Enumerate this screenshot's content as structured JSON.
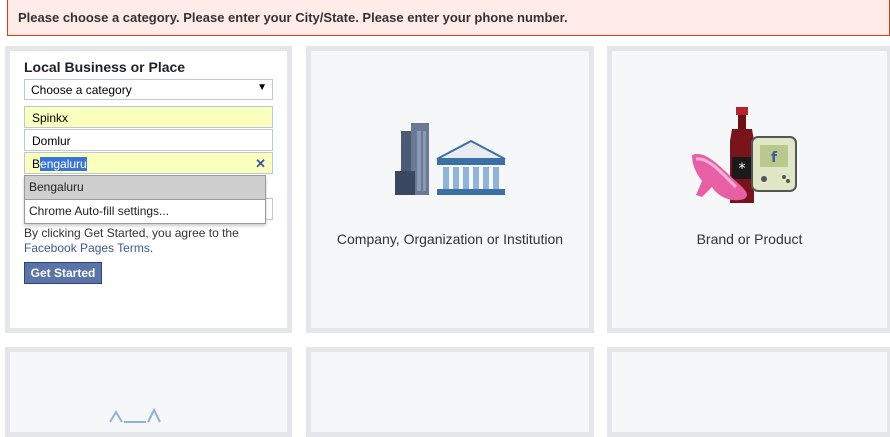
{
  "error": {
    "message": "Please choose a category. Please enter your City/State. Please enter your phone number."
  },
  "local_business": {
    "title": "Local Business or Place",
    "category_select": {
      "value": "Choose a category"
    },
    "fields": {
      "name": "Spinkx",
      "street": "Domlur",
      "city_first_char": "B",
      "city_selected": "engaluru"
    },
    "autofill": {
      "suggestion": "Bengaluru",
      "settings": "Chrome Auto-fill settings..."
    },
    "terms_prefix": "By clicking Get Started, you agree to the",
    "terms_link": "Facebook Pages Terms",
    "terms_suffix": ".",
    "button": "Get Started"
  },
  "tiles": [
    {
      "label": "Company, Organization or Institution",
      "icon": "building-institution-icon"
    },
    {
      "label": "Brand or Product",
      "icon": "brand-product-icon"
    }
  ],
  "colors": {
    "error_bg": "#ffebe8",
    "error_border": "#dd3c10",
    "link": "#3b5998",
    "button": "#5b74a8",
    "autofill": "#faffbd"
  }
}
